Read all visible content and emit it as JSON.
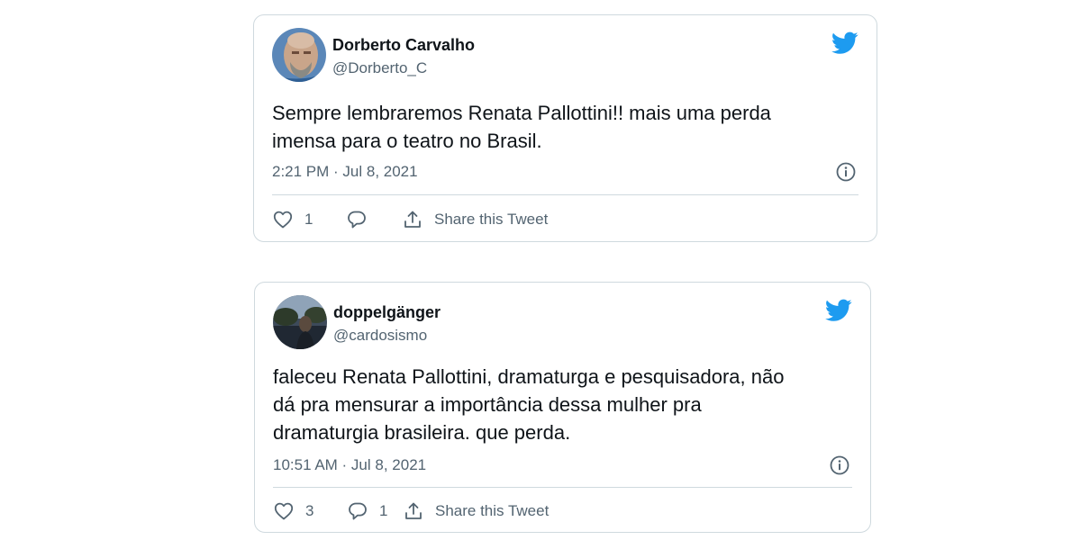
{
  "tweets": [
    {
      "author_name": "Dorberto Carvalho",
      "handle": "@Dorberto_C",
      "text": "Sempre lembraremos Renata Pallottini!! mais uma perda\nimensa para o teatro no Brasil.",
      "timestamp": "2:21 PM · Jul 8, 2021",
      "like_count": "1",
      "reply_count": "",
      "share_label": "Share this Tweet"
    },
    {
      "author_name": "doppelgänger",
      "handle": "@cardosismo",
      "text": "faleceu Renata Pallottini, dramaturga e pesquisadora, não\ndá pra mensurar a importância dessa mulher pra\ndramaturgia brasileira. que perda.",
      "timestamp": "10:51 AM · Jul 8, 2021",
      "like_count": "3",
      "reply_count": "1",
      "share_label": "Share this Tweet"
    }
  ],
  "icons": {
    "brand": "twitter-bird-icon",
    "info": "info-icon",
    "like": "heart-icon",
    "reply": "reply-icon",
    "share": "share-icon"
  },
  "colors": {
    "twitter_blue": "#1d9bf0",
    "secondary_text": "#536471",
    "border": "#cfd9de"
  }
}
